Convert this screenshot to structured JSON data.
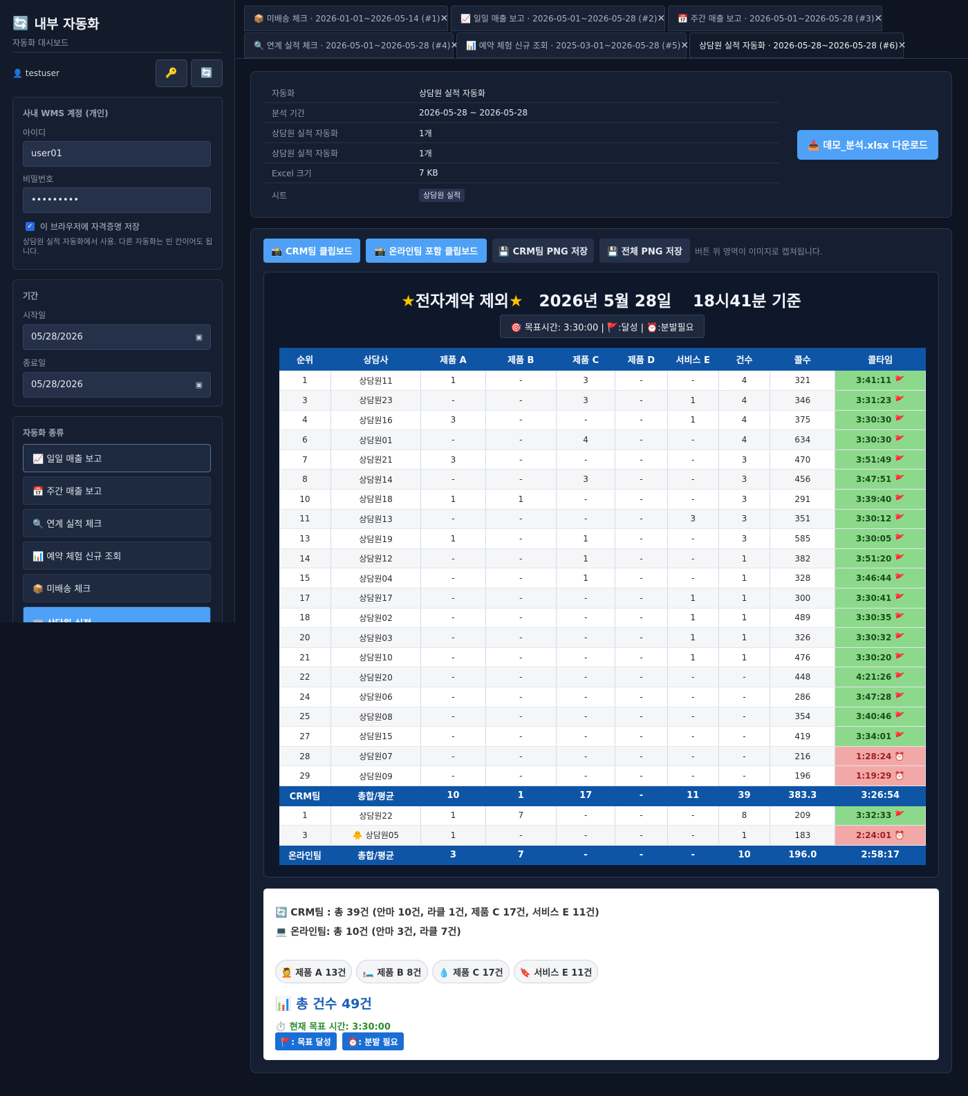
{
  "sidebar": {
    "brand_icon": "🔄",
    "brand_title": "내부 자동화",
    "brand_sub": "자동화 대시보드",
    "user": "👤 testuser",
    "key_icon": "🔑",
    "refresh_icon": "🔄",
    "wms": {
      "title": "사내 WMS 계정 (개인)",
      "id_label": "아이디",
      "id_value": "user01",
      "pw_label": "비밀번호",
      "pw_value": "•••••••••",
      "remember": "이 브라우저에 자격증명 저장",
      "help": "상담원 실적 자동화에서 사용. 다른 자동화는 빈 칸이어도 됩니다."
    },
    "period": {
      "title": "기간",
      "start_label": "시작일",
      "start_value": "05/28/2026",
      "end_label": "종료일",
      "end_value": "05/28/2026"
    },
    "automation": {
      "title": "자동화 종류",
      "items": [
        {
          "label": "📈 일일 매출 보고"
        },
        {
          "label": "📅 주간 매출 보고"
        },
        {
          "label": "🔍 연계 실적 체크"
        },
        {
          "label": "📊 예약 체험 신규 조회"
        },
        {
          "label": "📦 미배송 체크"
        },
        {
          "label": "🏢 상담원 실적"
        }
      ]
    }
  },
  "tabs": [
    {
      "label": "📦 미배송 체크 · 2026-01-01~2026-05-14 (#1)"
    },
    {
      "label": "📈 일일 매출 보고 · 2026-05-01~2026-05-28 (#2)"
    },
    {
      "label": "📅 주간 매출 보고 · 2026-05-01~2026-05-28 (#3)"
    },
    {
      "label": "🔍 연계 실적 체크 · 2026-05-01~2026-05-28 (#4)"
    },
    {
      "label": "📊 예약 체험 신규 조회 · 2025-03-01~2026-05-28 (#5)"
    },
    {
      "label": "상담원 실적 자동화 · 2026-05-28~2026-05-28 (#6)"
    }
  ],
  "info": {
    "rows": [
      {
        "k": "자동화",
        "v": "상담원 실적 자동화"
      },
      {
        "k": "분석 기간",
        "v": "2026-05-28 ~ 2026-05-28"
      },
      {
        "k": "상담원 실적 자동화",
        "v": "1개"
      },
      {
        "k": "상담원 실적 자동화",
        "v": "1개"
      },
      {
        "k": "Excel 크기",
        "v": "7 KB"
      },
      {
        "k": "시트",
        "v": "상담원 실적"
      }
    ],
    "download": "📥 데모_분석.xlsx 다운로드"
  },
  "actions": {
    "crm_clip": "📸 CRM팀 클립보드",
    "online_clip": "📸 온라인팀 포함 클립보드",
    "crm_png": "💾 CRM팀 PNG 저장",
    "all_png": "💾 전체 PNG 저장",
    "note": "버튼 위 영역이 이미지로 캡쳐됩니다."
  },
  "capture": {
    "title_star": "★",
    "title_main": "전자계약 제외",
    "title_rest": "2026년 5월 28일　 18시41분 기준",
    "legend": "🎯 목표시간: 3:30:00 | 🚩:달성 | ⏰:분발필요",
    "headers": [
      "순위",
      "상담사",
      "제품 A",
      "제품 B",
      "제품 C",
      "제품 D",
      "서비스 E",
      "건수",
      "콜수",
      "콜타임"
    ],
    "crm_rows": [
      [
        "1",
        "상담원11",
        "1",
        "-",
        "3",
        "-",
        "-",
        "4",
        "321",
        "3:41:11 🚩",
        "g"
      ],
      [
        "3",
        "상담원23",
        "-",
        "-",
        "3",
        "-",
        "1",
        "4",
        "346",
        "3:31:23 🚩",
        "g"
      ],
      [
        "4",
        "상담원16",
        "3",
        "-",
        "-",
        "-",
        "1",
        "4",
        "375",
        "3:30:30 🚩",
        "g"
      ],
      [
        "6",
        "상담원01",
        "-",
        "-",
        "4",
        "-",
        "-",
        "4",
        "634",
        "3:30:30 🚩",
        "g"
      ],
      [
        "7",
        "상담원21",
        "3",
        "-",
        "-",
        "-",
        "-",
        "3",
        "470",
        "3:51:49 🚩",
        "g"
      ],
      [
        "8",
        "상담원14",
        "-",
        "-",
        "3",
        "-",
        "-",
        "3",
        "456",
        "3:47:51 🚩",
        "g"
      ],
      [
        "10",
        "상담원18",
        "1",
        "1",
        "-",
        "-",
        "-",
        "3",
        "291",
        "3:39:40 🚩",
        "g"
      ],
      [
        "11",
        "상담원13",
        "-",
        "-",
        "-",
        "-",
        "3",
        "3",
        "351",
        "3:30:12 🚩",
        "g"
      ],
      [
        "13",
        "상담원19",
        "1",
        "-",
        "1",
        "-",
        "-",
        "3",
        "585",
        "3:30:05 🚩",
        "g"
      ],
      [
        "14",
        "상담원12",
        "-",
        "-",
        "1",
        "-",
        "-",
        "1",
        "382",
        "3:51:20 🚩",
        "g"
      ],
      [
        "15",
        "상담원04",
        "-",
        "-",
        "1",
        "-",
        "-",
        "1",
        "328",
        "3:46:44 🚩",
        "g"
      ],
      [
        "17",
        "상담원17",
        "-",
        "-",
        "-",
        "-",
        "1",
        "1",
        "300",
        "3:30:41 🚩",
        "g"
      ],
      [
        "18",
        "상담원02",
        "-",
        "-",
        "-",
        "-",
        "1",
        "1",
        "489",
        "3:30:35 🚩",
        "g"
      ],
      [
        "20",
        "상담원03",
        "-",
        "-",
        "-",
        "-",
        "1",
        "1",
        "326",
        "3:30:32 🚩",
        "g"
      ],
      [
        "21",
        "상담원10",
        "-",
        "-",
        "-",
        "-",
        "1",
        "1",
        "476",
        "3:30:20 🚩",
        "g"
      ],
      [
        "22",
        "상담원20",
        "-",
        "-",
        "-",
        "-",
        "-",
        "-",
        "448",
        "4:21:26 🚩",
        "g"
      ],
      [
        "24",
        "상담원06",
        "-",
        "-",
        "-",
        "-",
        "-",
        "-",
        "286",
        "3:47:28 🚩",
        "g"
      ],
      [
        "25",
        "상담원08",
        "-",
        "-",
        "-",
        "-",
        "-",
        "-",
        "354",
        "3:40:46 🚩",
        "g"
      ],
      [
        "27",
        "상담원15",
        "-",
        "-",
        "-",
        "-",
        "-",
        "-",
        "419",
        "3:34:01 🚩",
        "g"
      ],
      [
        "28",
        "상담원07",
        "-",
        "-",
        "-",
        "-",
        "-",
        "-",
        "216",
        "1:28:24 ⏰",
        "r"
      ],
      [
        "29",
        "상담원09",
        "-",
        "-",
        "-",
        "-",
        "-",
        "-",
        "196",
        "1:19:29 ⏰",
        "r"
      ]
    ],
    "crm_sum": [
      "CRM팀",
      "총합/평균",
      "10",
      "1",
      "17",
      "-",
      "11",
      "39",
      "383.3",
      "3:26:54"
    ],
    "online_rows": [
      [
        "1",
        "상담원22",
        "1",
        "7",
        "-",
        "-",
        "-",
        "8",
        "209",
        "3:32:33 🚩",
        "g"
      ],
      [
        "3",
        "🐥 상담원05",
        "1",
        "-",
        "-",
        "-",
        "-",
        "1",
        "183",
        "2:24:01 ⏰",
        "r"
      ]
    ],
    "online_sum": [
      "온라인팀",
      "총합/평균",
      "3",
      "7",
      "-",
      "-",
      "-",
      "10",
      "196.0",
      "2:58:17"
    ]
  },
  "summary": {
    "crm_line": "🔄 CRM팀 : 총 39건 (안마 10건, 라클 1건, 제품 C 17건, 서비스 E 11건)",
    "online_line": "💻 온라인팀: 총 10건 (안마 3건, 라클 7건)",
    "chips": [
      "💆 제품 A 13건",
      "🛏️ 제품 B 8건",
      "💧 제품 C 17건",
      "🔖 서비스 E 11건"
    ],
    "total": "📊 총 건수 49건",
    "target": "⏱️ 현재 목표 시간: 3:30:00",
    "tag_done": "🚩: 목표 달성",
    "tag_push": "⏰: 분발 필요"
  },
  "colors": {
    "accent": "#4ea1f6",
    "table_header": "#0e55a6",
    "achieved": "#8cd98c",
    "needs_push": "#f3a8a8"
  }
}
